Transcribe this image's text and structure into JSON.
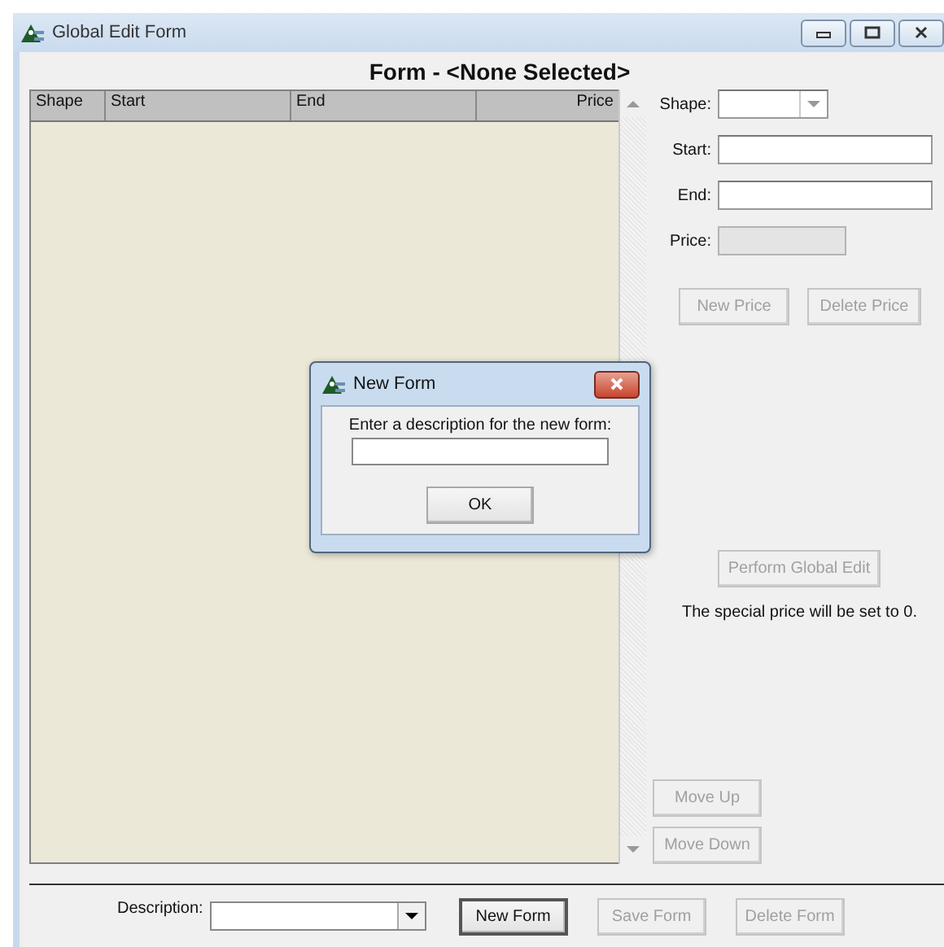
{
  "window": {
    "title": "Global Edit Form"
  },
  "form_title": "Form - <None Selected>",
  "grid": {
    "columns": [
      "Shape",
      "Start",
      "End",
      "Price"
    ]
  },
  "fields": [
    {
      "label": "Shape:",
      "kind": "dropdown",
      "disabled": false
    },
    {
      "label": "Start:",
      "kind": "text",
      "disabled": false
    },
    {
      "label": "End:",
      "kind": "text",
      "disabled": false
    },
    {
      "label": "Price:",
      "kind": "text",
      "disabled": true
    }
  ],
  "price_buttons": [
    {
      "label": "New Price",
      "disabled": true
    },
    {
      "label": "Delete Price",
      "disabled": true
    }
  ],
  "global_edit": {
    "button": {
      "label": "Perform Global Edit",
      "disabled": true
    },
    "note": "The special price will be set to 0."
  },
  "move_buttons": [
    {
      "label": "Move Up",
      "disabled": true
    },
    {
      "label": "Move Down",
      "disabled": true
    }
  ],
  "footer": {
    "description_label": "Description:",
    "buttons": [
      {
        "label": "New Form",
        "disabled": false
      },
      {
        "label": "Save Form",
        "disabled": true
      },
      {
        "label": "Delete Form",
        "disabled": true
      }
    ]
  },
  "dialog": {
    "title": "New Form",
    "prompt": "Enter a description for the new form:",
    "button": "OK"
  }
}
